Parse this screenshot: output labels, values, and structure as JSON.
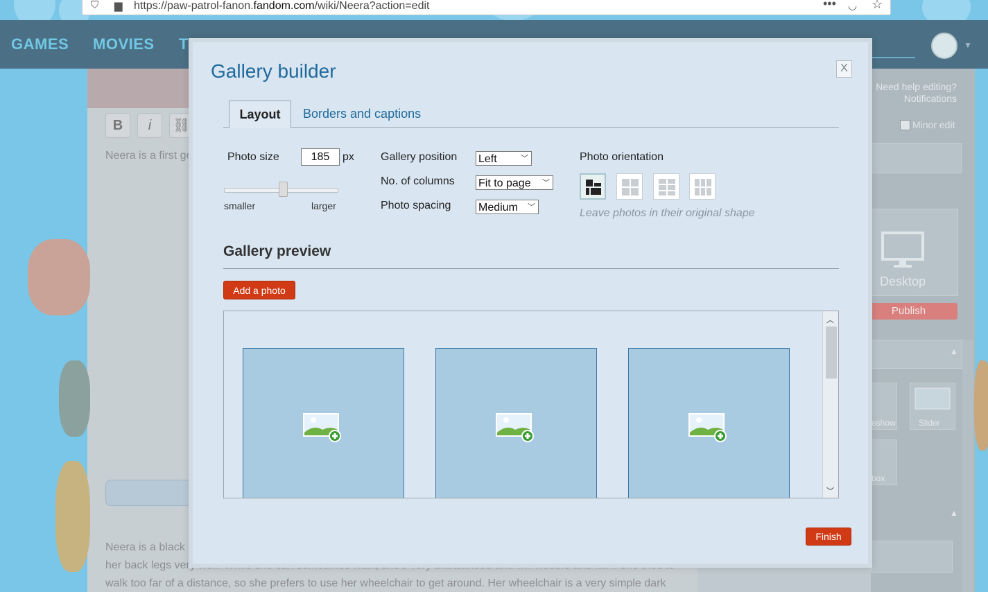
{
  "browser": {
    "url_prefix": "https://paw-patrol-fanon.",
    "url_domain": "fandom.com",
    "url_suffix": "/wiki/Neera?action=edit"
  },
  "site_nav": {
    "items": [
      "GAMES",
      "MOVIES",
      "TV"
    ]
  },
  "editor": {
    "toolbar": {
      "bold": "B",
      "italic": "i"
    },
    "intro_text": "Neera is a first ge",
    "body_lines": [
      "Neera is a black",
      "her back legs very well. While she can sometimes walk, she's very unbalanced and will wobble and fall if she tries to",
      "walk too far of a distance, so she prefers to use her wheelchair to get around. Her wheelchair is a very simple dark"
    ]
  },
  "right_panel": {
    "help_text": "Need help editing?",
    "notifications": "Notifications",
    "minor_edit": "Minor edit",
    "desktop_label": "Desktop",
    "publish": "Publish",
    "slideshow_label": "eshow",
    "slider_label": "Slider",
    "lightbox_label": "box"
  },
  "modal": {
    "title": "Gallery builder",
    "close": "X",
    "tabs": [
      {
        "label": "Layout",
        "active": true
      },
      {
        "label": "Borders and captions",
        "active": false
      }
    ],
    "photo_size": {
      "label": "Photo size",
      "value": "185",
      "unit": "px",
      "slider_min_label": "smaller",
      "slider_max_label": "larger",
      "slider_level": 0.52
    },
    "gallery_position": {
      "label": "Gallery position",
      "value": "Left"
    },
    "columns": {
      "label": "No. of columns",
      "value": "Fit to page"
    },
    "spacing": {
      "label": "Photo spacing",
      "value": "Medium"
    },
    "orientation": {
      "label": "Photo orientation",
      "options": [
        "original-shape-icon",
        "square-icon",
        "landscape-icon",
        "portrait-icon"
      ],
      "selected_index": 0,
      "hint": "Leave photos in their original shape"
    },
    "preview": {
      "title": "Gallery preview",
      "add_button": "Add a photo",
      "slots": 3
    },
    "finish": "Finish"
  },
  "colors": {
    "modal_bg": "#d9e6f1",
    "title_blue": "#1f6a9c",
    "action_red": "#d03a14",
    "slot_fill": "#a9cbe2"
  }
}
